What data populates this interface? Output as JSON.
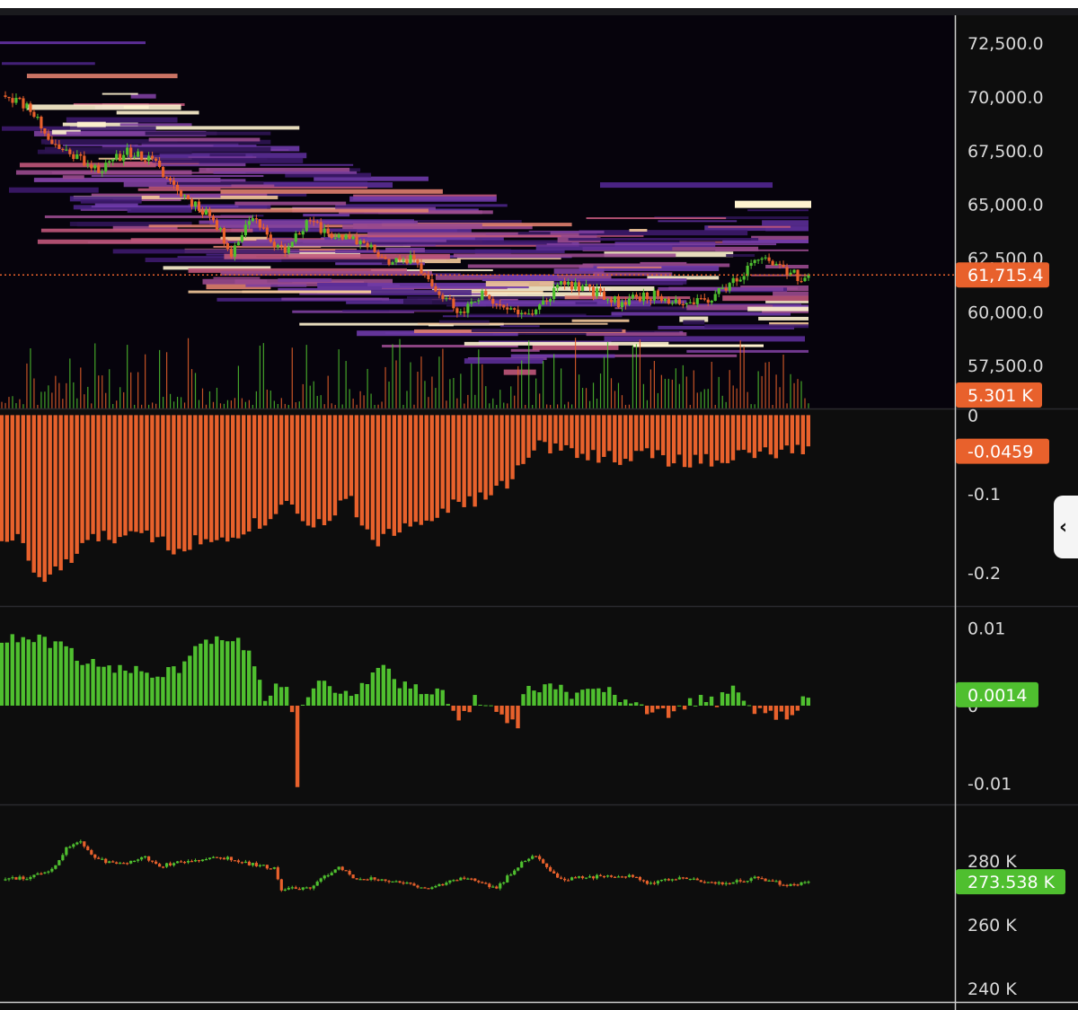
{
  "colors": {
    "background": "#0d0d0d",
    "heatmap_background": "#06030c",
    "up": "#4fbf2f",
    "down": "#e8612c",
    "price_line": "#e8612c",
    "axis_text": "#d9d9d9",
    "divider": "#2a2a2e",
    "axis_line": "#cccccc"
  },
  "icons": {
    "collapse": "chevron-left-icon"
  },
  "chart_data": [
    {
      "type": "candlestick-heatmap",
      "panel": "price",
      "y_ticks": [
        "72,500.0",
        "70,000.0",
        "67,500.0",
        "65,000.0",
        "62,500.0",
        "60,000.0",
        "57,500.0"
      ],
      "ylim": [
        55500,
        73800
      ],
      "last_price": 61715.4,
      "last_price_label": "61,715.4",
      "volume_label": "5.301 K",
      "price_path": [
        [
          0,
          70200
        ],
        [
          8,
          69500
        ],
        [
          14,
          67800
        ],
        [
          20,
          67300
        ],
        [
          28,
          66600
        ],
        [
          35,
          67500
        ],
        [
          42,
          67000
        ],
        [
          50,
          65500
        ],
        [
          58,
          64500
        ],
        [
          64,
          62800
        ],
        [
          70,
          64500
        ],
        [
          78,
          62800
        ],
        [
          86,
          64200
        ],
        [
          94,
          63400
        ],
        [
          102,
          63200
        ],
        [
          108,
          62200
        ],
        [
          114,
          62500
        ],
        [
          120,
          61400
        ],
        [
          128,
          59800
        ],
        [
          134,
          60900
        ],
        [
          140,
          60200
        ],
        [
          148,
          59800
        ],
        [
          156,
          61400
        ],
        [
          164,
          61000
        ],
        [
          172,
          60400
        ],
        [
          180,
          60800
        ],
        [
          190,
          60500
        ],
        [
          198,
          60600
        ],
        [
          204,
          61400
        ],
        [
          210,
          62400
        ],
        [
          214,
          62300
        ],
        [
          219,
          61900
        ],
        [
          225,
          61400
        ]
      ]
    },
    {
      "type": "bar",
      "panel": "indicator-1",
      "y_ticks": [
        "0",
        "-0.1",
        "-0.2"
      ],
      "ylim": [
        -0.24,
        0.005
      ],
      "last_value_label": "-0.0459",
      "value_path": [
        [
          0,
          -0.155
        ],
        [
          6,
          -0.16
        ],
        [
          10,
          -0.215
        ],
        [
          14,
          -0.2
        ],
        [
          18,
          -0.19
        ],
        [
          26,
          -0.155
        ],
        [
          36,
          -0.155
        ],
        [
          44,
          -0.155
        ],
        [
          48,
          -0.17
        ],
        [
          54,
          -0.16
        ],
        [
          58,
          -0.16
        ],
        [
          64,
          -0.15
        ],
        [
          70,
          -0.14
        ],
        [
          76,
          -0.13
        ],
        [
          80,
          -0.1
        ],
        [
          84,
          -0.13
        ],
        [
          90,
          -0.14
        ],
        [
          96,
          -0.1
        ],
        [
          102,
          -0.15
        ],
        [
          106,
          -0.16
        ],
        [
          112,
          -0.14
        ],
        [
          116,
          -0.135
        ],
        [
          120,
          -0.125
        ],
        [
          126,
          -0.115
        ],
        [
          132,
          -0.11
        ],
        [
          140,
          -0.09
        ],
        [
          144,
          -0.07
        ],
        [
          150,
          -0.04
        ],
        [
          160,
          -0.045
        ],
        [
          170,
          -0.055
        ],
        [
          180,
          -0.05
        ],
        [
          190,
          -0.06
        ],
        [
          200,
          -0.055
        ],
        [
          210,
          -0.05
        ],
        [
          225,
          -0.045
        ]
      ]
    },
    {
      "type": "bar",
      "panel": "indicator-2",
      "y_ticks": [
        "0.01",
        "0",
        "-0.01"
      ],
      "ylim": [
        -0.0125,
        0.0125
      ],
      "last_value_label": "0.0014",
      "value_path": [
        [
          0,
          0.0085
        ],
        [
          10,
          0.0085
        ],
        [
          18,
          0.0075
        ],
        [
          24,
          0.0055
        ],
        [
          30,
          0.0045
        ],
        [
          38,
          0.0048
        ],
        [
          44,
          0.004
        ],
        [
          50,
          0.005
        ],
        [
          54,
          0.008
        ],
        [
          60,
          0.009
        ],
        [
          66,
          0.0085
        ],
        [
          70,
          0.0065
        ],
        [
          72,
          0.0035
        ],
        [
          74,
          0.0005
        ],
        [
          78,
          0.003
        ],
        [
          80,
          0.0015
        ],
        [
          82,
          -0.0045
        ],
        [
          84,
          -0.0005
        ],
        [
          86,
          0.002
        ],
        [
          90,
          0.003
        ],
        [
          96,
          0.0015
        ],
        [
          100,
          0.002
        ],
        [
          106,
          0.0055
        ],
        [
          110,
          0.003
        ],
        [
          116,
          0.002
        ],
        [
          124,
          0.0012
        ],
        [
          128,
          -0.0015
        ],
        [
          132,
          0.0008
        ],
        [
          140,
          -0.0015
        ],
        [
          144,
          -0.0025
        ],
        [
          146,
          0.0018
        ],
        [
          152,
          0.0028
        ],
        [
          160,
          0.0012
        ],
        [
          164,
          0.0018
        ],
        [
          170,
          0.0018
        ],
        [
          176,
          -0.0002
        ],
        [
          180,
          -0.0008
        ],
        [
          186,
          -0.0012
        ],
        [
          192,
          0.0006
        ],
        [
          200,
          0.0006
        ],
        [
          204,
          0.0022
        ],
        [
          208,
          -0.0002
        ],
        [
          214,
          -0.0012
        ],
        [
          220,
          -0.0012
        ],
        [
          224,
          0.0014
        ]
      ]
    },
    {
      "type": "candlestick",
      "panel": "indicator-3",
      "y_ticks": [
        "280 K",
        "260 K",
        "240 K"
      ],
      "ylim": [
        236000,
        297000
      ],
      "last_value_label": "273.538 K",
      "value_path": [
        [
          0,
          274500
        ],
        [
          8,
          275000
        ],
        [
          14,
          277500
        ],
        [
          18,
          284000
        ],
        [
          22,
          286500
        ],
        [
          26,
          280500
        ],
        [
          34,
          279000
        ],
        [
          40,
          281500
        ],
        [
          44,
          278500
        ],
        [
          50,
          279500
        ],
        [
          56,
          280500
        ],
        [
          62,
          281000
        ],
        [
          68,
          279500
        ],
        [
          72,
          278500
        ],
        [
          76,
          278000
        ],
        [
          78,
          271000
        ],
        [
          86,
          272000
        ],
        [
          92,
          276500
        ],
        [
          94,
          278500
        ],
        [
          98,
          275000
        ],
        [
          110,
          273500
        ],
        [
          120,
          271500
        ],
        [
          128,
          275000
        ],
        [
          138,
          271500
        ],
        [
          144,
          278500
        ],
        [
          148,
          282000
        ],
        [
          152,
          278500
        ],
        [
          156,
          274000
        ],
        [
          168,
          275500
        ],
        [
          176,
          275000
        ],
        [
          180,
          273000
        ],
        [
          190,
          274500
        ],
        [
          200,
          273000
        ],
        [
          210,
          274500
        ],
        [
          214,
          273500
        ],
        [
          220,
          272500
        ],
        [
          225,
          273538
        ]
      ]
    }
  ]
}
